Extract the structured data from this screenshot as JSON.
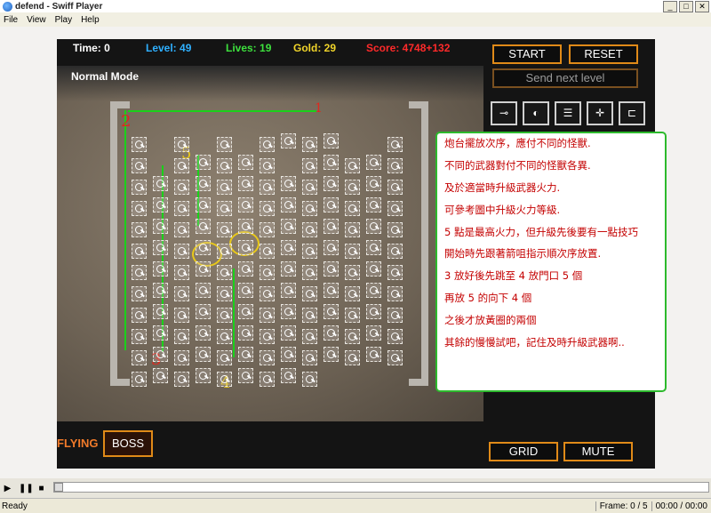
{
  "window": {
    "title": "defend - Swiff Player"
  },
  "menu": [
    "File",
    "View",
    "Play",
    "Help"
  ],
  "hud": {
    "time": "Time: 0",
    "level": "Level: 49",
    "lives": "Lives: 19",
    "gold": "Gold: 29",
    "score": "Score: 4748+132",
    "mode": "Normal Mode"
  },
  "buttons": {
    "start": "START",
    "reset": "RESET",
    "send_next": "Send next level",
    "grid": "GRID",
    "mute": "MUTE"
  },
  "weapons": [
    "gun-tower-icon",
    "cannon-tower-icon",
    "flame-tower-icon",
    "crosshair-tower-icon",
    "magnet-tower-icon"
  ],
  "path_labels": [
    "1",
    "2",
    "3",
    "4",
    "5"
  ],
  "note": [
    "炮台擺放次序，應付不同的怪獸.",
    "不同的武器對付不同的怪獸各異.",
    "及於適當時升級武器火力.",
    "可參考圖中升級火力等級.",
    "5 點是最高火力，但升級先後要有一點技巧",
    "開始時先跟著箭咀指示順次序放置.",
    "3 放好後先跳至 4 放門口 5 個",
    "再放 5 的向下 4 個",
    "之後才放黃圈的兩個",
    "其餘的慢慢試吧，記住及時升級武器啊.."
  ],
  "bottom": {
    "flying": "FLYING",
    "boss": "BOSS"
  },
  "statusbar": {
    "status": "Ready",
    "frame": "Frame: 0 / 5",
    "time": "00:00 / 00:00"
  },
  "colors": {
    "accent": "#e08a18",
    "path": "#1ad11a",
    "note_text": "#c40000"
  }
}
